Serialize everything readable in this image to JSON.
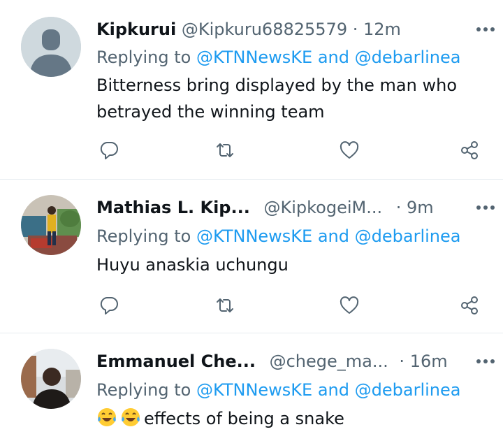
{
  "tweets": [
    {
      "name": "Kipkurui",
      "handle": "@Kipkuru68825579",
      "separator": "·",
      "time": "12m",
      "replying_prefix": "Replying to",
      "mention1": "@KTNNewsKE",
      "and_word": "and",
      "mention2": "@debarlinea",
      "text_line1": "Bitterness bring displayed by the man who",
      "text_line2": "betrayed the winning team",
      "avatar": "default-profile-avatar"
    },
    {
      "name": "Mathias L. Kip...",
      "handle": "@KipkogeiM...",
      "separator": "·",
      "time": "9m",
      "replying_prefix": "Replying to",
      "mention1": "@KTNNewsKE",
      "and_word": "and",
      "mention2": "@debarlinea",
      "text_line1": "Huyu anaskia uchungu",
      "avatar": "photo-avatar-person-standing"
    },
    {
      "name": "Emmanuel Che...",
      "handle": "@chege_ma...",
      "separator": "·",
      "time": "16m",
      "replying_prefix": "Replying to",
      "mention1": "@KTNNewsKE",
      "and_word": "and",
      "mention2": "@debarlinea",
      "text_line1": "effects of being a snake",
      "emoji": [
        "tears-of-joy-emoji",
        "tears-of-joy-emoji"
      ],
      "avatar": "photo-avatar-portrait"
    }
  ],
  "colors": {
    "link": "#1d9bf0",
    "secondary_text": "#536471",
    "primary_text": "#0f1419",
    "divider": "#e6ecf0"
  },
  "icons": [
    "reply-icon",
    "retweet-icon",
    "like-icon",
    "share-icon",
    "more-icon"
  ]
}
